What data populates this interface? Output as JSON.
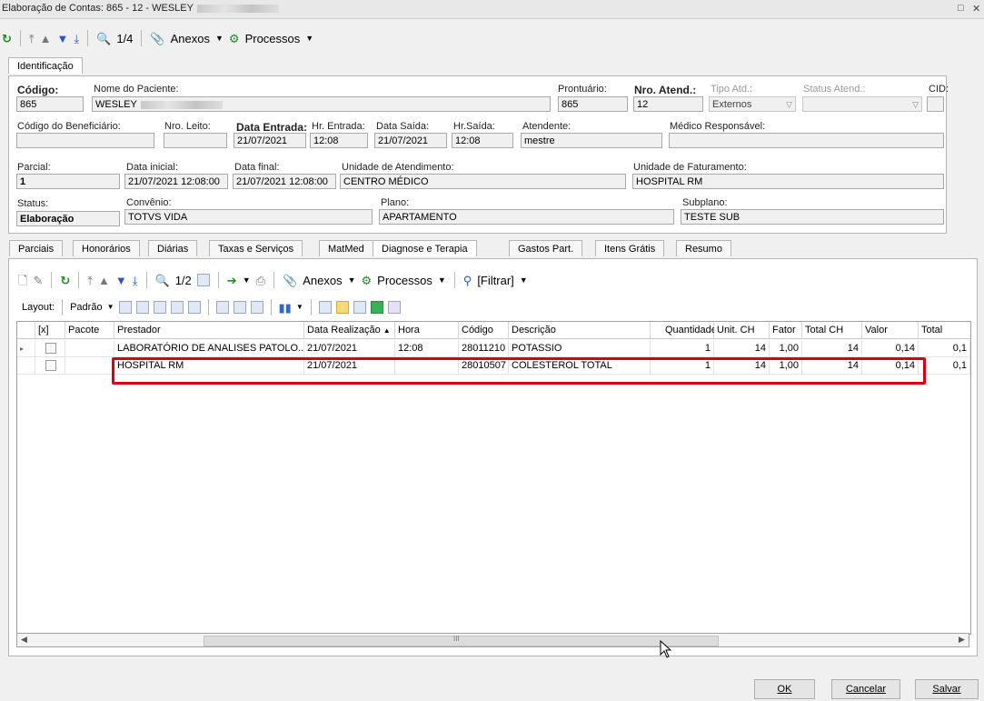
{
  "window": {
    "title": "Elaboração de Contas: 865 - 12 - WESLEY",
    "restore_glyph": "□",
    "close_glyph": "✕"
  },
  "toolbar": {
    "counter": "1/4",
    "anexos_label": "Anexos",
    "processos_label": "Processos"
  },
  "top_tab": {
    "label": "Identificação"
  },
  "form": {
    "codigo_label": "Código:",
    "codigo_value": "865",
    "nome_label": "Nome do Paciente:",
    "nome_value": "WESLEY",
    "prontuario_label": "Prontuário:",
    "prontuario_value": "865",
    "nro_atend_label": "Nro. Atend.:",
    "nro_atend_value": "12",
    "tipo_atd_label": "Tipo Atd.:",
    "tipo_atd_value": "Externos",
    "status_atend_label": "Status Atend.:",
    "status_atend_value": "",
    "cid_label": "CID:",
    "cid_value": "",
    "cod_benef_label": "Código do Beneficiário:",
    "cod_benef_value": "",
    "nro_leito_label": "Nro. Leito:",
    "nro_leito_value": "",
    "data_entrada_label": "Data Entrada:",
    "data_entrada_value": "21/07/2021",
    "hr_entrada_label": "Hr. Entrada:",
    "hr_entrada_value": "12:08",
    "data_saida_label": "Data Saída:",
    "data_saida_value": "21/07/2021",
    "hr_saida_label": "Hr.Saída:",
    "hr_saida_value": "12:08",
    "atendente_label": "Atendente:",
    "atendente_value": "mestre",
    "medico_label": "Médico Responsável:",
    "medico_value": "",
    "parcial_label": "Parcial:",
    "parcial_value": "1",
    "data_inicial_label": "Data inicial:",
    "data_inicial_value": "21/07/2021 12:08:00",
    "data_final_label": "Data final:",
    "data_final_value": "21/07/2021 12:08:00",
    "unidade_atend_label": "Unidade de Atendimento:",
    "unidade_atend_value": "CENTRO MÉDICO",
    "unidade_fat_label": "Unidade de Faturamento:",
    "unidade_fat_value": "HOSPITAL RM",
    "status_label": "Status:",
    "status_value": "Elaboração",
    "convenio_label": "Convênio:",
    "convenio_value": "TOTVS VIDA",
    "plano_label": "Plano:",
    "plano_value": "APARTAMENTO",
    "subplano_label": "Subplano:",
    "subplano_value": "TESTE SUB"
  },
  "tabs": [
    "Parciais",
    "Honorários",
    "Diárias",
    "Taxas e Serviços",
    "MatMed",
    "Diagnose e Terapia",
    "Gastos Part.",
    "Itens Grátis",
    "Resumo"
  ],
  "inner_toolbar": {
    "counter": "1/2",
    "anexos_label": "Anexos",
    "processos_label": "Processos",
    "filtrar_label": "[Filtrar]"
  },
  "layout_bar": {
    "layout_label": "Layout:",
    "padrao_label": "Padrão"
  },
  "grid": {
    "columns": [
      "[x]",
      "Pacote",
      "Prestador",
      "Data Realização",
      "Hora",
      "Código",
      "Descrição",
      "Quantidade",
      "Unit. CH",
      "Fator",
      "Total CH",
      "Valor",
      "Total"
    ],
    "sort_glyph": "▲",
    "rows": [
      {
        "prestador": "LABORATÓRIO DE ANALISES PATOLO...",
        "data": "21/07/2021",
        "hora": "12:08",
        "codigo": "28011210",
        "descricao": "POTASSIO",
        "quantidade": "1",
        "unit_ch": "14",
        "fator": "1,00",
        "total_ch": "14",
        "valor": "0,14",
        "total": "0,1"
      },
      {
        "prestador": "HOSPITAL RM",
        "data": "21/07/2021",
        "hora": "",
        "codigo": "28010507",
        "descricao": "COLESTEROL TOTAL",
        "quantidade": "1",
        "unit_ch": "14",
        "fator": "1,00",
        "total_ch": "14",
        "valor": "0,14",
        "total": "0,1"
      }
    ]
  },
  "scrollbar": {
    "left_glyph": "◀",
    "right_glyph": "▶",
    "grip_glyph": "III"
  },
  "buttons": {
    "ok": "OK",
    "cancelar": "Cancelar",
    "salvar": "Salvar"
  }
}
